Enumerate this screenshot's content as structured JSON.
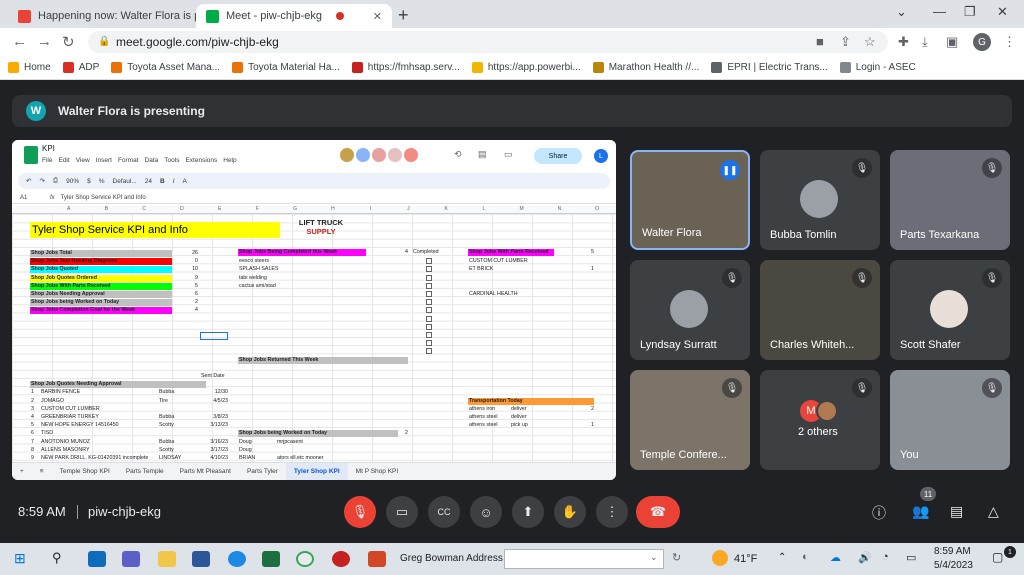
{
  "browser": {
    "tabs": [
      {
        "label": "Happening now: Walter Flora is p",
        "color": "#ea4335"
      },
      {
        "label": "Meet - piw-chjb-ekg",
        "color": "#00ac47"
      }
    ],
    "url": "meet.google.com/piw-chjb-ekg",
    "profile_initial": "G",
    "bookmarks": [
      {
        "label": "Home",
        "color": "#f9ab00"
      },
      {
        "label": "ADP",
        "color": "#d93025"
      },
      {
        "label": "Toyota Asset Mana...",
        "color": "#e8710a"
      },
      {
        "label": "Toyota Material Ha...",
        "color": "#e8710a"
      },
      {
        "label": "https://fmhsap.serv...",
        "color": "#c5221f"
      },
      {
        "label": "https://app.powerbi...",
        "color": "#f2b600"
      },
      {
        "label": "Marathon Health //...",
        "color": "#b8860b"
      },
      {
        "label": "EPRI | Electric Trans...",
        "color": "#5f6368"
      },
      {
        "label": "Login - ASEC",
        "color": "#80868b"
      }
    ]
  },
  "meet": {
    "presenter_initial": "W",
    "presenting_text": "Walter Flora is presenting",
    "time": "8:59 AM",
    "code": "piw-chjb-ekg",
    "participant_count": "11",
    "colors": {
      "mic_off": "#ea4335",
      "end_call": "#ea4335",
      "active_speaker": "#8ab4f8"
    }
  },
  "sheet": {
    "title": "KPI",
    "menu": [
      "File",
      "Edit",
      "View",
      "Insert",
      "Format",
      "Data",
      "Tools",
      "Extensions",
      "Help"
    ],
    "share_label": "Share",
    "user_initial": "L",
    "toolbar": {
      "zoom": "90%",
      "font": "Defaul...",
      "font_size": "24"
    },
    "formula_ref": "A1",
    "formula_text": "Tyler Shop Service KPI and Info",
    "big_title": "Tyler Shop Service KPI and Info",
    "logo_line1": "LIFT TRUCK",
    "logo_line2": "SUPPLY",
    "kpis": [
      {
        "label": "Shop Jobs Total",
        "value": "26",
        "color": "#c0c0c0"
      },
      {
        "label": "Shop Jobs Test Needing Diagnose",
        "value": "0",
        "color": "#ff0000"
      },
      {
        "label": "Shop Jobs Quoted",
        "value": "10",
        "color": "#00ffff"
      },
      {
        "label": "Shop Job Quotes Ordered",
        "value": "9",
        "color": "#ffff00"
      },
      {
        "label": "Shop Jobs With Parts Received",
        "value": "5",
        "color": "#00ff00"
      },
      {
        "label": "Shop Jobs Needing Approval",
        "value": "6",
        "color": "#c0c0c0"
      },
      {
        "label": "Shop Jobs being Worked on Today",
        "value": "2",
        "color": "#c0c0c0"
      },
      {
        "label": "Shop Jobs Completion Goal for the Week",
        "value": "4",
        "color": "#ff00ff"
      }
    ],
    "completed_header": "Shop Jobs Being Completed this Week",
    "completed_count": "4",
    "completed_col": "Completed",
    "completed_jobs": [
      "eesco steers",
      "SPLASH SALES",
      "tabi welding",
      "cactus ami/stad"
    ],
    "parts_header": "Shop Jobs With Parts Received",
    "parts_count": "5",
    "parts_jobs": [
      {
        "name": "CUSTOM CUT LUMBER",
        "value": ""
      },
      {
        "name": "ET BRICK",
        "value": "1"
      },
      {
        "name": "",
        "value": ""
      },
      {
        "name": "",
        "value": ""
      },
      {
        "name": "CARDINAL HEALTH",
        "value": ""
      }
    ],
    "returned_header": "Shop Jobs Returned This Week",
    "sent_date_label": "Sent Date",
    "quotes_header": "Shop Job Quotes Needing Approval",
    "quotes": [
      {
        "n": "1",
        "name": "BARBIN FENCE",
        "who": "Bubba",
        "date": "12/30"
      },
      {
        "n": "2",
        "name": "JOMAGO",
        "who": "Tire",
        "date": "4/5/23"
      },
      {
        "n": "3",
        "name": "CUSTOM CUT LUMBER",
        "who": "",
        "date": ""
      },
      {
        "n": "4",
        "name": "GREENBRIAR TURKEY",
        "who": "Bubba",
        "date": "3/8/23"
      },
      {
        "n": "5",
        "name": "NEW HOPE ENERGY 14516450",
        "who": "Scotty",
        "date": "3/13/23"
      },
      {
        "n": "6",
        "name": "TISD",
        "who": "",
        "date": ""
      },
      {
        "n": "7",
        "name": "ANOTONIO MUNOZ",
        "who": "Bubba",
        "date": "3/16/23"
      },
      {
        "n": "8",
        "name": "ALLENS MASONRY",
        "who": "Scotty",
        "date": "3/17/23"
      },
      {
        "n": "9",
        "name": "NEW PARK DRILL. KG-01420391 incomplete",
        "who": "LINDSAY",
        "date": "4/10/23"
      }
    ],
    "worked_header": "Shop Jobs being Worked on Today",
    "worked_count": "2",
    "worked": [
      {
        "who": "Doug",
        "job": "mrjpcasent"
      },
      {
        "who": "Doug",
        "job": ""
      },
      {
        "who": "BRIAN",
        "job": "ators ell.etc mooner"
      }
    ],
    "transport_header": "Transportation Today",
    "transport": [
      {
        "who": "athens iron",
        "what": "deliver",
        "n": "2"
      },
      {
        "who": "athens steel",
        "what": "deliver",
        "n": ""
      },
      {
        "who": "athens steel",
        "what": "pick up",
        "n": "1"
      }
    ],
    "tabs": [
      "Temple Shop KPI",
      "Parts Temple",
      "Parts Mt Pleasant",
      "Parts Tyler",
      "Tyler Shop KPI",
      "Mt P Shop KPI"
    ],
    "active_tab": "Tyler Shop KPI"
  },
  "participants": [
    {
      "name": "Walter Flora",
      "speaking": true
    },
    {
      "name": "Bubba Tomlin"
    },
    {
      "name": "Parts Texarkana"
    },
    {
      "name": "Lyndsay Surratt"
    },
    {
      "name": "Charles Whiteh..."
    },
    {
      "name": "Scott Shafer"
    },
    {
      "name": "Temple Confere..."
    },
    {
      "name": "2 others",
      "initial": "M"
    },
    {
      "name": "You"
    }
  ],
  "taskbar": {
    "user_text": "Greg Bowman Address",
    "temperature": "41°F",
    "clock_time": "8:59 AM",
    "clock_date": "5/4/2023",
    "notif_count": "1"
  }
}
